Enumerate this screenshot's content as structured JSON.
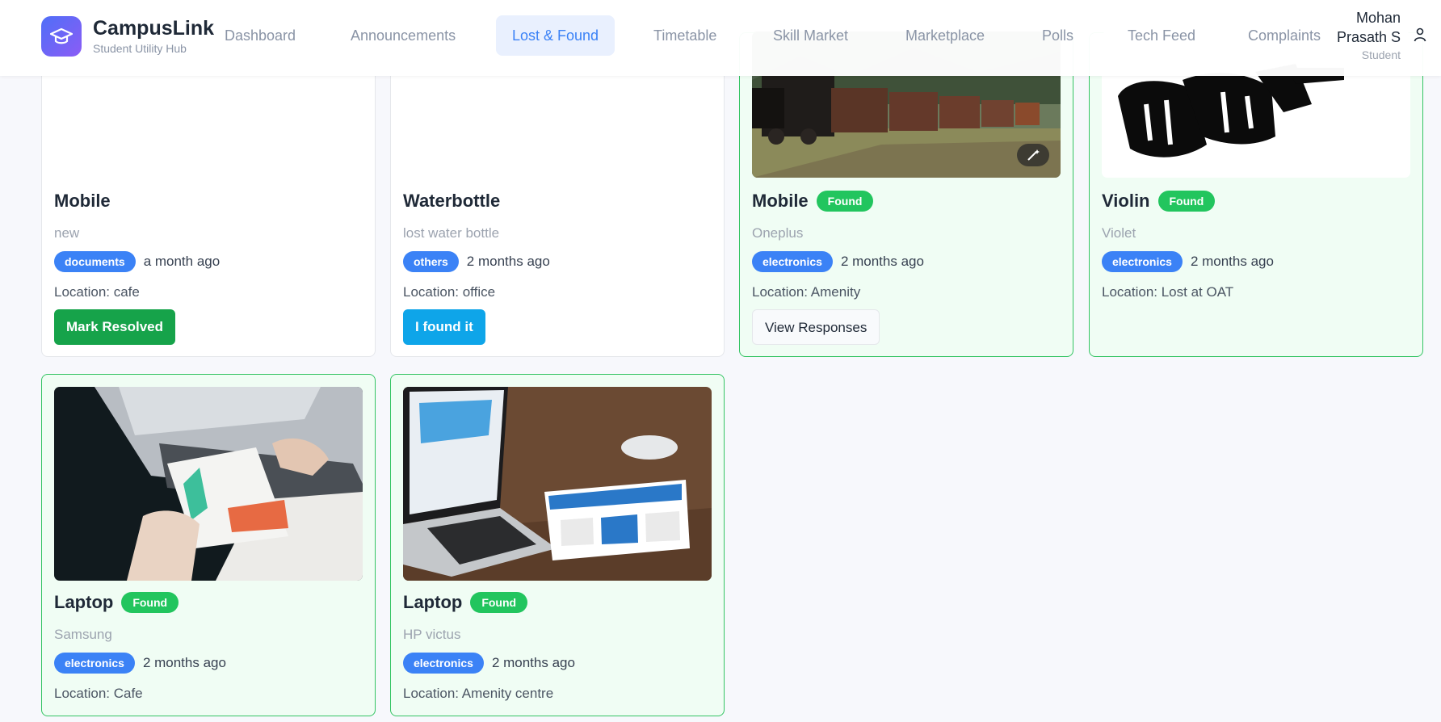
{
  "app": {
    "title": "CampusLink",
    "subtitle": "Student Utility Hub",
    "logo_icon": "graduation-cap-icon"
  },
  "nav": [
    {
      "label": "Dashboard"
    },
    {
      "label": "Announcements"
    },
    {
      "label": "Lost & Found",
      "active": true
    },
    {
      "label": "Timetable"
    },
    {
      "label": "Skill Market"
    },
    {
      "label": "Marketplace"
    },
    {
      "label": "Polls"
    },
    {
      "label": "Tech Feed"
    },
    {
      "label": "Complaints"
    }
  ],
  "user": {
    "name_line1": "Mohan",
    "name_line2": "Prasath S",
    "role": "Student",
    "icon": "user-icon"
  },
  "cards": [
    {
      "title": "Mobile",
      "description": "new",
      "category": "documents",
      "time": "a month ago",
      "location": "Location: cafe",
      "action": "Mark Resolved"
    },
    {
      "title": "Waterbottle",
      "description": "lost water bottle",
      "category": "others",
      "time": "2 months ago",
      "location": "Location: office",
      "action": "I found it"
    },
    {
      "title": "Mobile",
      "status": "Found",
      "description": "Oneplus",
      "category": "electronics",
      "time": "2 months ago",
      "location": "Location: Amenity",
      "action": "View Responses",
      "image": "steam train photo"
    },
    {
      "title": "Violin",
      "status": "Found",
      "description": "Violet",
      "category": "electronics",
      "time": "2 months ago",
      "location": "Location: Lost at OAT",
      "image": "music lettering artwork"
    },
    {
      "title": "Laptop",
      "status": "Found",
      "description": "Samsung",
      "category": "electronics",
      "time": "2 months ago",
      "location": "Location: Cafe",
      "image": "laptop with documents photo"
    },
    {
      "title": "Laptop",
      "status": "Found",
      "description": "HP victus",
      "category": "electronics",
      "time": "2 months ago",
      "location": "Location: Amenity centre",
      "image": "laptop and tablet photo"
    }
  ],
  "colors": {
    "accent": "#3b82f6",
    "found": "#22c55e",
    "found_border": "#34c463",
    "resolve": "#16a34a",
    "found_it": "#0ea5e9"
  }
}
